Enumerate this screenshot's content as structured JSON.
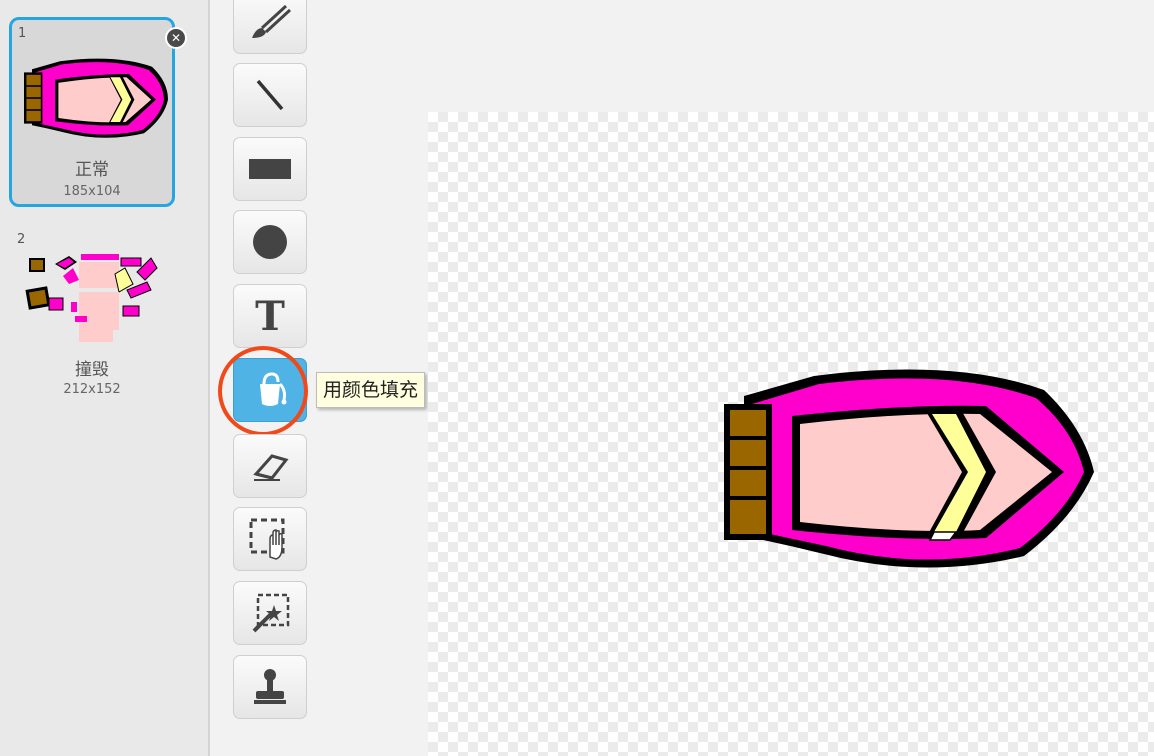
{
  "costumes": [
    {
      "number": "1",
      "name": "正常",
      "size": "185x104",
      "selected": true
    },
    {
      "number": "2",
      "name": "撞毁",
      "size": "212x152",
      "selected": false
    }
  ],
  "tools": [
    {
      "name": "brush",
      "icon": "brush-icon"
    },
    {
      "name": "line",
      "icon": "line-icon"
    },
    {
      "name": "rectangle",
      "icon": "rectangle-icon"
    },
    {
      "name": "ellipse",
      "icon": "ellipse-icon"
    },
    {
      "name": "text",
      "icon": "text-icon",
      "glyph": "T"
    },
    {
      "name": "fill",
      "icon": "paint-bucket-icon",
      "active": true
    },
    {
      "name": "eraser",
      "icon": "eraser-icon"
    },
    {
      "name": "select",
      "icon": "select-icon"
    },
    {
      "name": "reshape",
      "icon": "magic-wand-select-icon"
    },
    {
      "name": "stamp",
      "icon": "stamp-icon"
    }
  ],
  "tooltip": {
    "text": "用颜色填充"
  },
  "colors": {
    "selection_border": "#25a6e0",
    "active_tool": "#4fb3e5",
    "highlight_ring": "#f04a1a",
    "boat_hull": "#ff00cc",
    "boat_deck": "#ffcccc",
    "boat_windshield": "#ffff99",
    "boat_stern": "#996600"
  }
}
